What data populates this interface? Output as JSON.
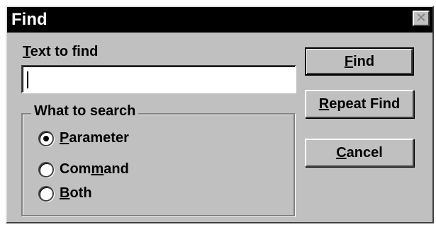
{
  "window": {
    "title": "Find",
    "close_symbol": "✕"
  },
  "text_to_find": {
    "label_mnemonic": "T",
    "label_rest": "ext to find",
    "value": ""
  },
  "what_to_search": {
    "legend": "What to search",
    "options": [
      {
        "pre": "",
        "mnemonic": "P",
        "rest": "arameter",
        "selected": true
      },
      {
        "pre": "Com",
        "mnemonic": "m",
        "rest": "and",
        "selected": false
      },
      {
        "pre": "",
        "mnemonic": "B",
        "rest": "oth",
        "selected": false
      }
    ]
  },
  "buttons": {
    "find": {
      "mnemonic": "F",
      "rest": "ind"
    },
    "repeat_find": {
      "mnemonic": "R",
      "rest": "epeat Find"
    },
    "cancel": {
      "mnemonic": "C",
      "rest": "ancel"
    }
  }
}
